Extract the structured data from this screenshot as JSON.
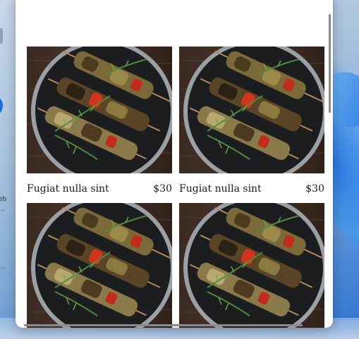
{
  "desktop": {
    "icon_labels": [
      "eb",
      "...",
      "..."
    ]
  },
  "products": [
    {
      "name": "Fugiat nulla sint",
      "price": "$30",
      "image": "grilled-skewers-photo"
    },
    {
      "name": "Fugiat nulla sint",
      "price": "$30",
      "image": "grilled-skewers-photo"
    },
    {
      "name": "",
      "price": "",
      "image": "grilled-skewers-photo"
    },
    {
      "name": "",
      "price": "",
      "image": "grilled-skewers-photo"
    }
  ]
}
